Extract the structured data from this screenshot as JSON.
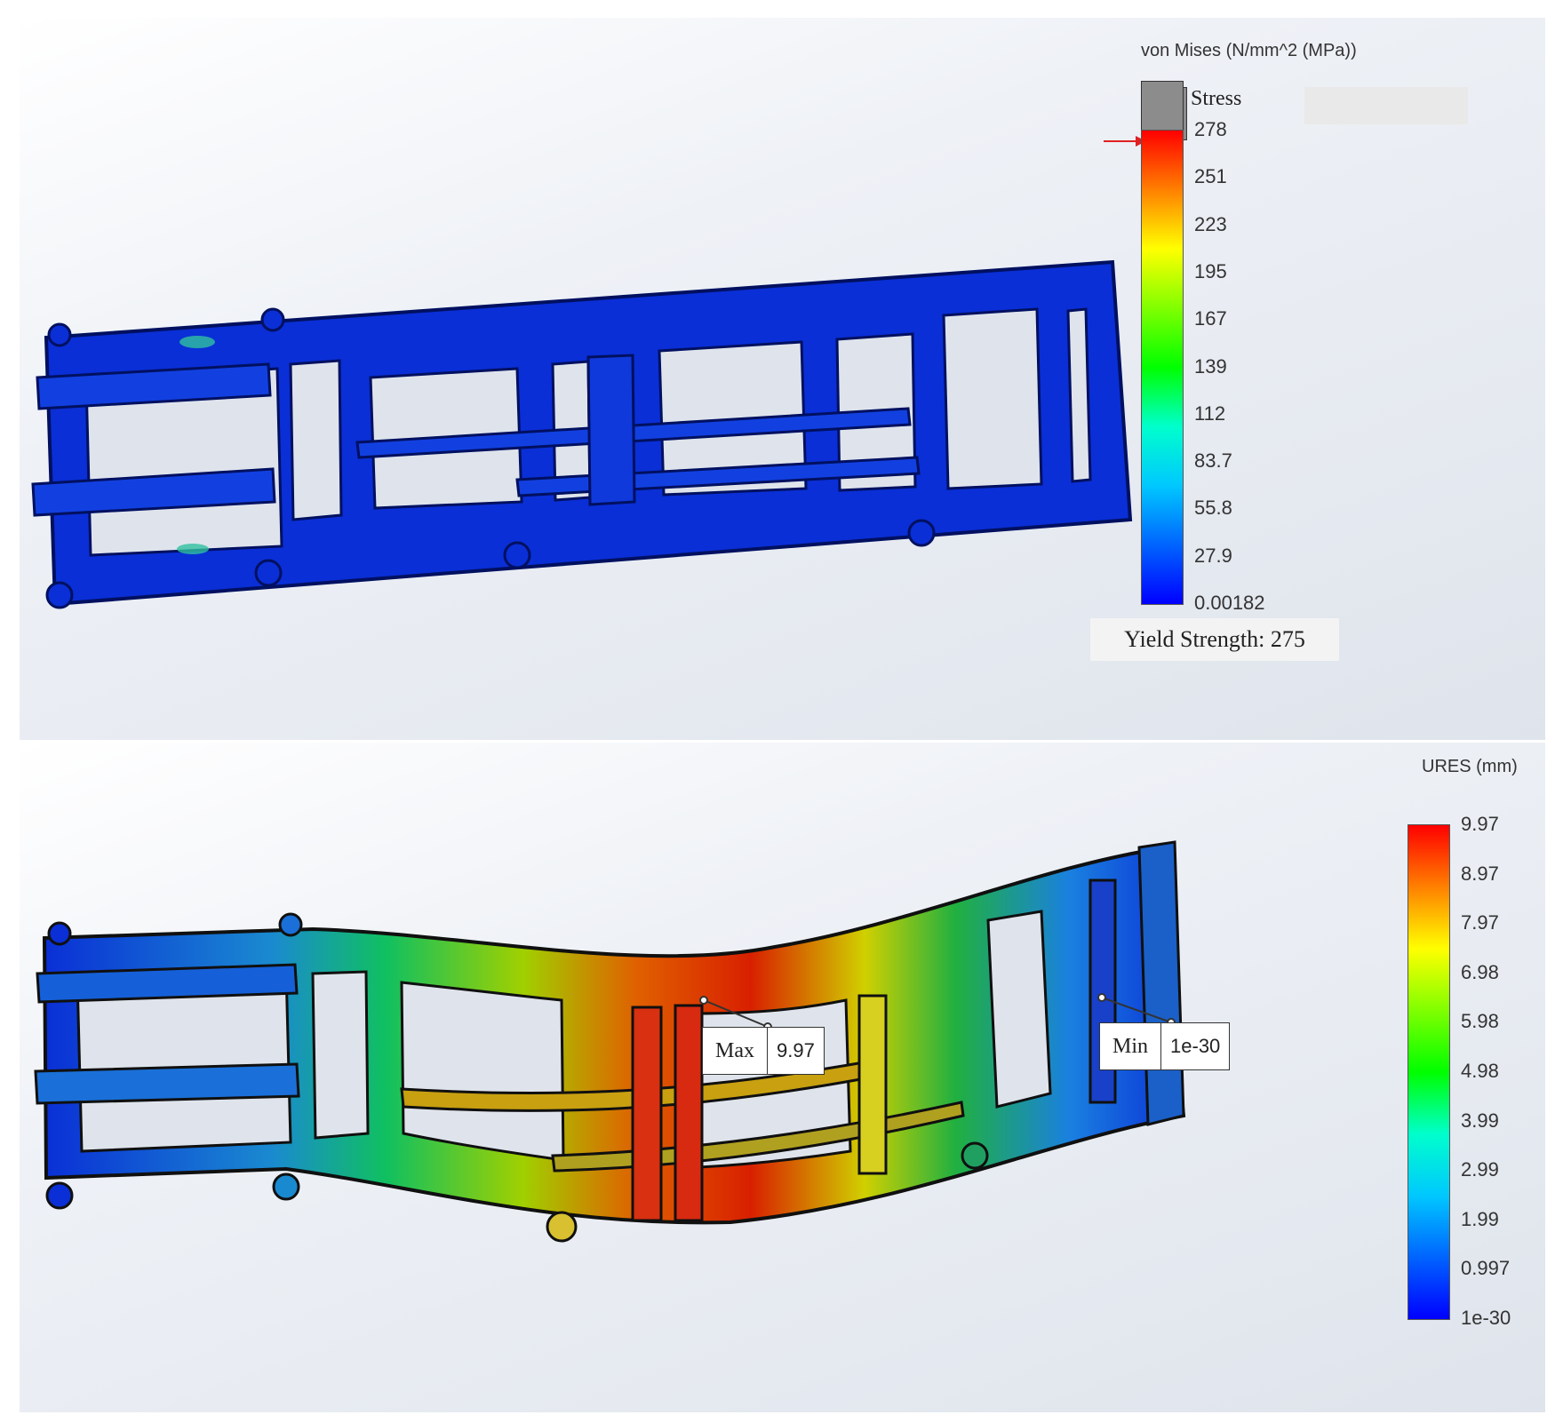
{
  "stress_plot": {
    "legend_title": "von Mises (N/mm^2 (MPa))",
    "box_label": "Stress",
    "ticks": [
      "278",
      "251",
      "223",
      "195",
      "167",
      "139",
      "112",
      "83.7",
      "55.8",
      "27.9",
      "0.00182"
    ],
    "yield_label": "Yield Strength: 275",
    "arrow_color": "#e02020"
  },
  "displacement_plot": {
    "legend_title": "URES (mm)",
    "ticks": [
      "9.97",
      "8.97",
      "7.97",
      "6.98",
      "5.98",
      "4.98",
      "3.99",
      "2.99",
      "1.99",
      "0.997",
      "1e-30"
    ],
    "max_probe": {
      "label": "Max",
      "value": "9.97"
    },
    "min_probe": {
      "label": "Min",
      "value": "1e-30"
    }
  },
  "colormap": [
    "#ff0000",
    "#ff8000",
    "#ffff00",
    "#80ff00",
    "#00ff00",
    "#00ffcc",
    "#00c8ff",
    "#0064ff",
    "#0000ff"
  ]
}
